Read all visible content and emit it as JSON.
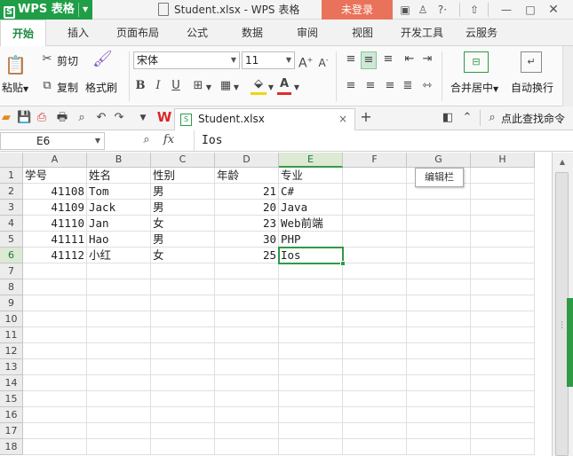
{
  "titlebar": {
    "app_name": "WPS 表格",
    "app_logo_letter": "S",
    "window_title": "Student.xlsx - WPS 表格",
    "login_label": "未登录",
    "help_label": "?"
  },
  "ribbon_tabs": [
    "开始",
    "插入",
    "页面布局",
    "公式",
    "数据",
    "审阅",
    "视图",
    "开发工具",
    "云服务"
  ],
  "active_tab": "开始",
  "ribbon": {
    "paste_label": "粘贴",
    "cut_label": "剪切",
    "copy_label": "复制",
    "format_painter_label": "格式刷",
    "font_name": "宋体",
    "font_size": "11",
    "bold": "B",
    "italic": "I",
    "underline": "U",
    "merge_center_label": "合并居中",
    "wrap_text_label": "自动换行"
  },
  "doc_tab": {
    "name": "Student.xlsx",
    "close": "×",
    "new": "+"
  },
  "find_command_label": "点此查找命令",
  "formula_bar": {
    "cell_ref": "E6",
    "fx": "fx",
    "value": "Ios"
  },
  "tooltip": "编辑栏",
  "grid": {
    "columns": [
      "A",
      "B",
      "C",
      "D",
      "E",
      "F",
      "G",
      "H"
    ],
    "row_numbers": [
      "1",
      "2",
      "3",
      "4",
      "5",
      "6",
      "7",
      "8",
      "9",
      "10",
      "11",
      "12",
      "13",
      "14",
      "15",
      "16",
      "17",
      "18"
    ],
    "rows": [
      [
        "学号",
        "姓名",
        "性别",
        "年龄",
        "专业"
      ],
      [
        "41108",
        "Tom",
        "男",
        "21",
        "C#"
      ],
      [
        "41109",
        "Jack",
        "男",
        "20",
        "Java"
      ],
      [
        "41110",
        "Jan",
        "女",
        "23",
        "Web前端"
      ],
      [
        "41111",
        "Hao",
        "男",
        "30",
        "PHP"
      ],
      [
        "41112",
        "小红",
        "女",
        "25",
        "Ios"
      ]
    ],
    "selected_cell": "E6"
  },
  "colors": {
    "brand_green": "#1f9e47",
    "login_orange": "#e9735a",
    "selection_green": "#2e9a45"
  }
}
